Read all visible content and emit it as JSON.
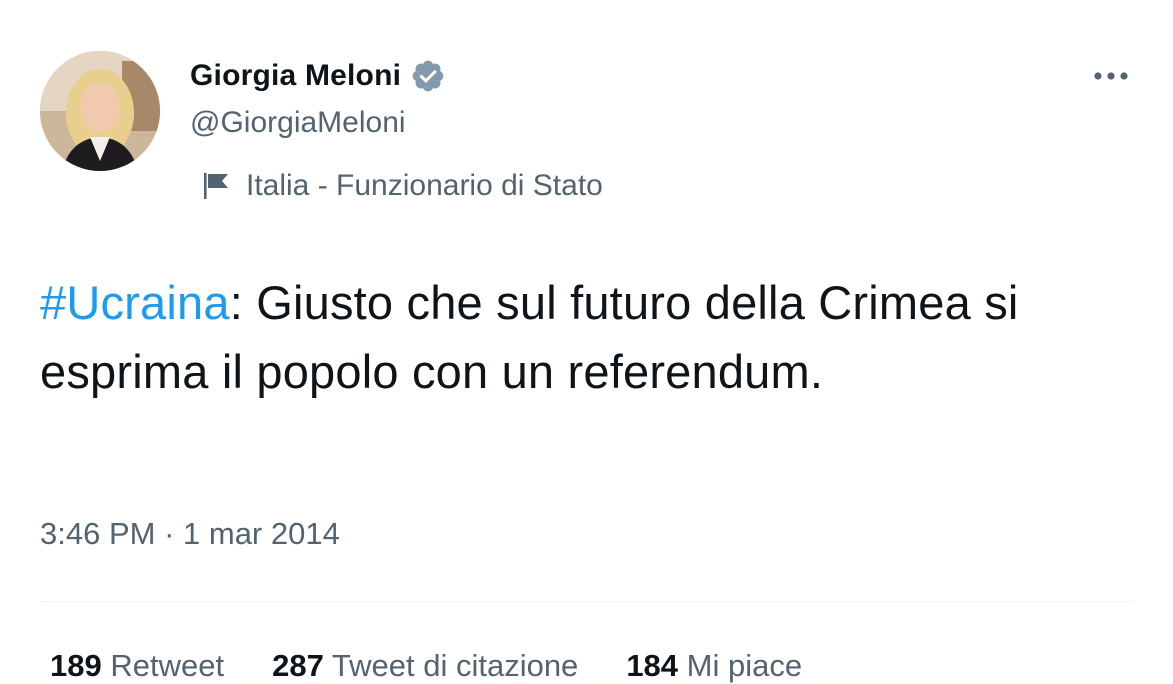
{
  "author": {
    "display_name": "Giorgia Meloni",
    "handle": "@GiorgiaMeloni",
    "verified": true,
    "label": "Italia - Funzionario di Stato"
  },
  "tweet": {
    "hashtag": "#Ucraina",
    "text": ": Giusto che sul futuro della Crimea si esprima il popolo con un referendum.",
    "time": "3:46 PM",
    "separator": " · ",
    "date": "1 mar 2014"
  },
  "stats": [
    {
      "count": "189",
      "label": "Retweet"
    },
    {
      "count": "287",
      "label": "Tweet di citazione"
    },
    {
      "count": "184",
      "label": "Mi piace"
    }
  ],
  "icons": {
    "verified": "verified-badge-icon",
    "more": "more-options-icon",
    "label_flag": "flag-icon"
  },
  "colors": {
    "text": "#0f1419",
    "secondary": "#536471",
    "hashtag": "#1d9bf0",
    "verified": "#829aab",
    "divider": "#eff3f4"
  }
}
